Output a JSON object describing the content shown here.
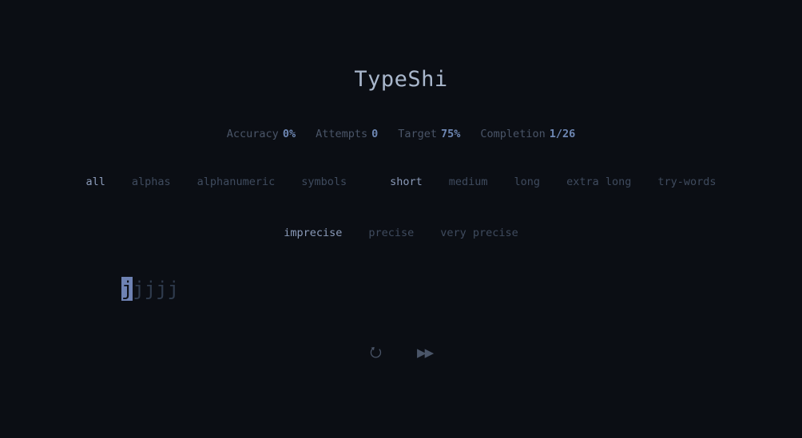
{
  "app": {
    "title": "TypeShi"
  },
  "stats": {
    "accuracy_label": "Accuracy",
    "accuracy_value": "0%",
    "attempts_label": "Attempts",
    "attempts_value": "0",
    "target_label": "Target",
    "target_value": "75%",
    "completion_label": "Completion",
    "completion_value": "1/26"
  },
  "charset_options": [
    {
      "label": "all",
      "active": true
    },
    {
      "label": "alphas",
      "active": false
    },
    {
      "label": "alphanumeric",
      "active": false
    },
    {
      "label": "symbols",
      "active": false
    }
  ],
  "length_options": [
    {
      "label": "short",
      "active": true
    },
    {
      "label": "medium",
      "active": false
    },
    {
      "label": "long",
      "active": false
    },
    {
      "label": "extra long",
      "active": false
    },
    {
      "label": "try-words",
      "active": false
    }
  ],
  "precision_options": [
    {
      "label": "imprecise",
      "active": true
    },
    {
      "label": "precise",
      "active": false
    },
    {
      "label": "very precise",
      "active": false
    }
  ],
  "typing": {
    "chars": [
      "j",
      "j",
      "j",
      "j",
      "j"
    ],
    "cursor_index": 0
  },
  "controls": {
    "restart_icon": "restart-icon",
    "restart_glyph": "⭮",
    "next_icon": "fast-forward-icon",
    "next_glyph": "▶▶"
  },
  "colors": {
    "background": "#0b0e14",
    "accent": "#6e82b3",
    "muted": "#3f4b5e",
    "active": "#8a9ab8"
  }
}
